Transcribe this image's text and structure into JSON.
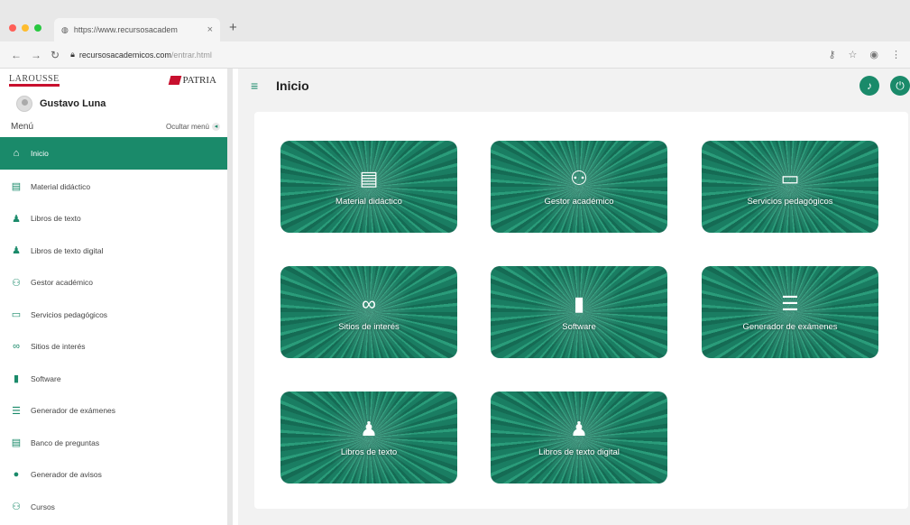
{
  "browser": {
    "tab_title": "https://www.recursosacadem",
    "url_host": "recursosacademicos.com",
    "url_path": "/entrar.html"
  },
  "sidebar": {
    "brand_left": "LAROUSSE",
    "brand_right": "PATRIA",
    "user_name": "Gustavo Luna",
    "menu_title": "Menú",
    "hide_menu": "Ocultar menú",
    "items": [
      {
        "label": "Inicio",
        "icon": "home-icon",
        "glyph": "⌂"
      },
      {
        "label": "Material didáctico",
        "icon": "book-icon",
        "glyph": "▤"
      },
      {
        "label": "Libros de texto",
        "icon": "reader-icon",
        "glyph": "♟"
      },
      {
        "label": "Libros de texto digital",
        "icon": "reader-icon",
        "glyph": "♟"
      },
      {
        "label": "Gestor académico",
        "icon": "users-icon",
        "glyph": "⚇"
      },
      {
        "label": "Servicios pedagógicos",
        "icon": "presentation-icon",
        "glyph": "▭"
      },
      {
        "label": "Sitios de interés",
        "icon": "link-icon",
        "glyph": "∞"
      },
      {
        "label": "Software",
        "icon": "chip-icon",
        "glyph": "▮"
      },
      {
        "label": "Generador de exámenes",
        "icon": "checklist-icon",
        "glyph": "☰"
      },
      {
        "label": "Banco de preguntas",
        "icon": "book-icon",
        "glyph": "▤"
      },
      {
        "label": "Generador de avisos",
        "icon": "info-icon",
        "glyph": "●"
      },
      {
        "label": "Cursos",
        "icon": "group-icon",
        "glyph": "⚇"
      }
    ]
  },
  "main": {
    "title": "Inicio",
    "tiles": [
      {
        "label": "Material didáctico",
        "icon": "book-icon",
        "glyph": "▤"
      },
      {
        "label": "Gestor académico",
        "icon": "users-icon",
        "glyph": "⚇"
      },
      {
        "label": "Servicios pedagógicos",
        "icon": "presentation-icon",
        "glyph": "▭"
      },
      {
        "label": "Sitios de interés",
        "icon": "link-icon",
        "glyph": "∞"
      },
      {
        "label": "Software",
        "icon": "chip-icon",
        "glyph": "▮"
      },
      {
        "label": "Generador de exámenes",
        "icon": "checklist-icon",
        "glyph": "☰"
      },
      {
        "label": "Libros de texto",
        "icon": "reader-icon",
        "glyph": "♟"
      },
      {
        "label": "Libros de texto digital",
        "icon": "reader-icon",
        "glyph": "♟"
      }
    ]
  },
  "colors": {
    "accent": "#1a8a6a",
    "brand_red": "#c8102e"
  }
}
